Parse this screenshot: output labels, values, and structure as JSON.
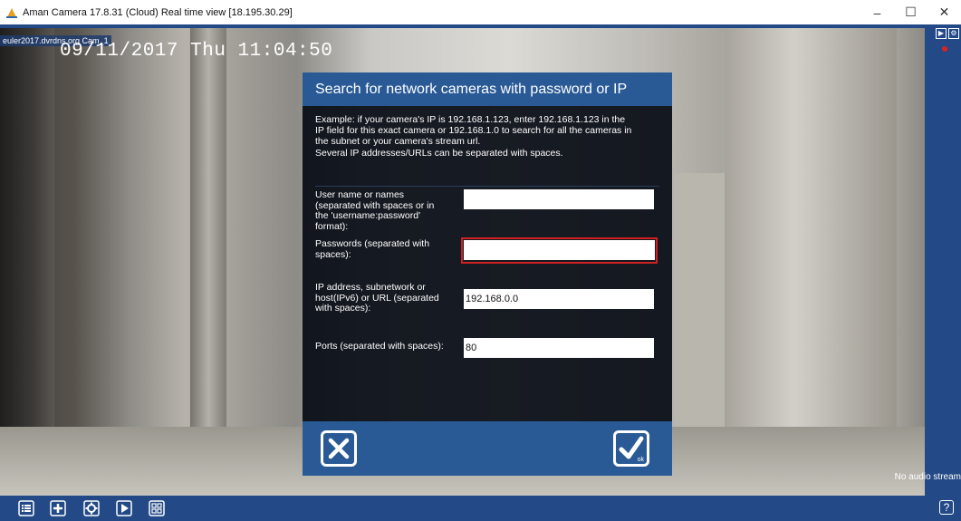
{
  "window": {
    "title": "Aman Camera 17.8.31 (Cloud) Real time view [18.195.30.29]",
    "minimize": "–",
    "maximize": "☐",
    "close": "✕"
  },
  "video": {
    "camera_label": "euler2017.dvrdns.org Cam_1",
    "timestamp": "09/11/2017 Thu 11:04:50",
    "audio_status": "No audio stream"
  },
  "dialog": {
    "title": "Search for network cameras with password or IP",
    "description_lines": [
      "Example: if your camera's IP is 192.168.1.123, enter 192.168.1.123 in the",
      "IP field for this exact camera or 192.168.1.0 to search for all the cameras in",
      "the subnet or your camera's stream url.",
      "Several IP addresses/URLs can be separated with spaces."
    ],
    "fields": [
      {
        "label_lines": [
          "User name or names",
          "(separated with spaces or in",
          "the 'username:password'",
          "format):"
        ],
        "value": ""
      },
      {
        "label_lines": [
          "Passwords (separated with",
          "spaces):"
        ],
        "value": ""
      },
      {
        "label_lines": [
          "IP address, subnetwork or",
          "host(IPv6) or URL (separated",
          "with spaces):"
        ],
        "value": "192.168.0.0"
      },
      {
        "label_lines": [
          "Ports (separated with spaces):"
        ],
        "value": "80"
      }
    ],
    "ok_sub": "ok"
  },
  "colors": {
    "accent_blue": "#2a5a96",
    "focus_red": "#d02020",
    "rec_red": "#e02020"
  },
  "toolbar": {
    "icons": [
      "list-icon",
      "add-icon",
      "settings-icon",
      "play-icon",
      "grid-icon"
    ],
    "help_label": "?"
  }
}
